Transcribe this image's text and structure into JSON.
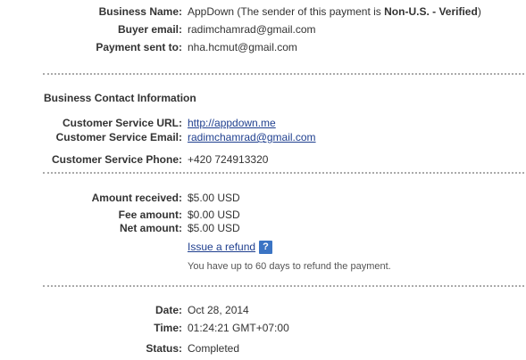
{
  "payment": {
    "business_name_label": "Business Name:",
    "business_name_value": "AppDown",
    "business_name_note_prefix": "(The sender of this payment is ",
    "business_name_note_bold": "Non-U.S. - Verified",
    "business_name_note_suffix": ")",
    "buyer_email_label": "Buyer email:",
    "buyer_email_value": "radimchamrad@gmail.com",
    "payment_sent_to_label": "Payment sent to:",
    "payment_sent_to_value": "nha.hcmut@gmail.com"
  },
  "contact": {
    "section_title": "Business Contact Information",
    "service_url_label": "Customer Service URL:",
    "service_url_value": "http://appdown.me",
    "service_email_label": "Customer Service Email:",
    "service_email_value": "radimchamrad@gmail.com",
    "service_phone_label": "Customer Service Phone:",
    "service_phone_value": "+420 724913320"
  },
  "amounts": {
    "received_label": "Amount received:",
    "received_value": "$5.00 USD",
    "fee_label": "Fee amount:",
    "fee_value": "$0.00 USD",
    "net_label": "Net amount:",
    "net_value": "$5.00 USD",
    "refund_link": "Issue a refund",
    "help_icon_glyph": "?",
    "refund_note": "You have up to 60 days to refund the payment."
  },
  "details": {
    "date_label": "Date:",
    "date_value": "Oct 28, 2014",
    "time_label": "Time:",
    "time_value": "01:24:21 GMT+07:00",
    "status_label": "Status:",
    "status_value": "Completed"
  }
}
